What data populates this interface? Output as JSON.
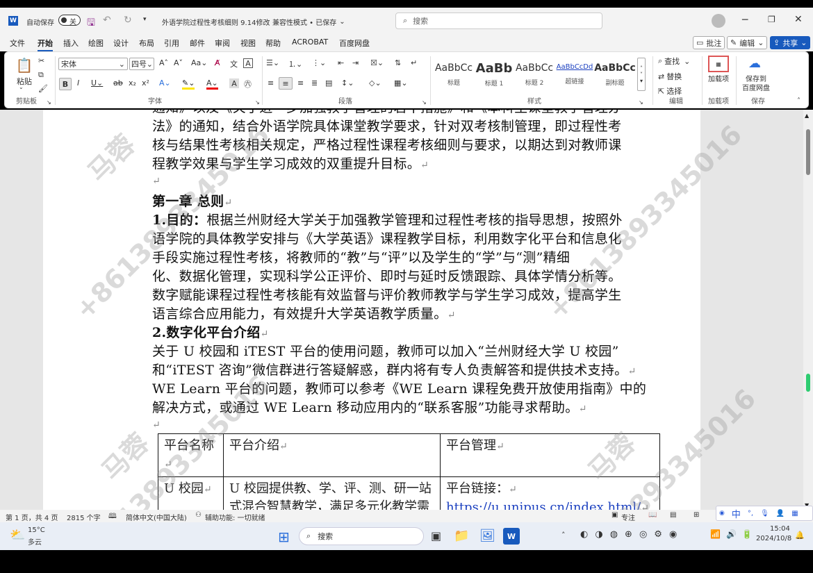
{
  "titlebar": {
    "autosave_label": "自动保存",
    "autosave_state": "关",
    "doc_title": "外语学院过程性考核细则 9.14修改",
    "doc_mode": "兼容性模式 • 已保存",
    "search_placeholder": "搜索"
  },
  "tabs": [
    "文件",
    "开始",
    "插入",
    "绘图",
    "设计",
    "布局",
    "引用",
    "邮件",
    "审阅",
    "视图",
    "帮助",
    "ACROBAT",
    "百度网盘"
  ],
  "tab_actions": {
    "comment": "批注",
    "edit": "编辑",
    "share": "共享"
  },
  "ribbon": {
    "clipboard": {
      "paste": "粘贴",
      "label": "剪贴板"
    },
    "font": {
      "font_name": "宋体",
      "font_size": "四号",
      "label": "字体"
    },
    "paragraph": {
      "label": "段落"
    },
    "styles": {
      "label": "样式",
      "items": [
        {
          "preview": "AaBbCc",
          "name": "标题"
        },
        {
          "preview": "AaBb",
          "name": "标题 1"
        },
        {
          "preview": "AaBbCc",
          "name": "标题 2"
        },
        {
          "preview": "AaBbCcDd",
          "name": "超链接"
        },
        {
          "preview": "AaBbCc",
          "name": "副标题"
        }
      ]
    },
    "editing": {
      "find": "查找",
      "replace": "替换",
      "select": "选择",
      "label": "编辑"
    },
    "addins": {
      "btn": "加载项",
      "label": "加载项"
    },
    "save": {
      "btn1": "保存到",
      "btn2": "百度网盘",
      "label": "保存"
    }
  },
  "document": {
    "lines": [
      {
        "text": "通知》以及《关于进一步加强教学管理的若干措施》和《本科生课堂教学管理办",
        "cls": ""
      },
      {
        "text": "法》的通知，结合外语学院具体课堂教学要求，针对双考核制管理，即过程性考",
        "cls": ""
      },
      {
        "text": "核与结果性考核相关规定，严格过程性课程考核细则与要求，以期达到对教师课",
        "cls": ""
      },
      {
        "text": "程教学效果与学生学习成效的双重提升目标。",
        "cls": "",
        "mark": "↵"
      },
      {
        "text": "",
        "cls": "",
        "mark": "↵"
      },
      {
        "text": "第一章  总则",
        "cls": "bold",
        "mark": "↵"
      },
      {
        "text": "1.目的：根据兰州财经大学关于加强教学管理和过程性考核的指导思想，按照外",
        "cls": "first-bold"
      },
      {
        "text": "语学院的具体教学安排与《大学英语》课程教学目标，利用数字化平台和信息化",
        "cls": ""
      },
      {
        "text": "手段实施过程性考核，将教师的“教”与“评”以及学生的“学”与“测”精细",
        "cls": ""
      },
      {
        "text": "化、数据化管理，实现科学公正评价、即时与延时反馈跟踪、具体学情分析等。",
        "cls": ""
      },
      {
        "text": "数字赋能课程过程性考核能有效监督与评价教师教学与学生学习成效，提高学生",
        "cls": ""
      },
      {
        "text": "语言综合应用能力，有效提升大学英语教学质量。",
        "cls": "",
        "mark": "↵"
      },
      {
        "text": "2.数字化平台介绍",
        "cls": "bold",
        "mark": "↵"
      },
      {
        "text": "    关于 U 校园和 iTEST 平台的使用问题，教师可以加入“兰州财经大学 U 校园”",
        "cls": ""
      },
      {
        "text": "和“iTEST 咨询”微信群进行答疑解惑，群内将有专人负责解答和提供技术支持。",
        "cls": "",
        "mark": "↵"
      },
      {
        "text": "WE Learn 平台的问题，教师可以参考《WE Learn 课程免费开放使用指南》中的",
        "cls": ""
      },
      {
        "text": "解决方式，或通过 WE Learn 移动应用内的“联系客服”功能寻求帮助。",
        "cls": "",
        "mark": "↵"
      },
      {
        "text": "",
        "cls": "",
        "mark": "↵"
      }
    ],
    "first_bold_prefix": "1.目的：",
    "table": {
      "headers": [
        "平台名称",
        "平台介绍",
        "平台管理"
      ],
      "rows": [
        [
          "U 校园",
          "U 校园提供教、学、评、测、研一站式混合智慧教学，满足多元化教学需",
          "平台链接：",
          "https://u.unipus.cn/index.html/"
        ]
      ]
    }
  },
  "watermark": {
    "name": "马蓉",
    "phone": "+8613893345016"
  },
  "statusbar": {
    "page": "第 1 页，共 4 页",
    "words": "2815 个字",
    "lang": "简体中文(中国大陆)",
    "access": "辅助功能: 一切就绪",
    "focus": "专注"
  },
  "taskbar": {
    "temp": "15°C",
    "weather": "多云",
    "search": "搜索",
    "time": "15:04",
    "date": "2024/10/8",
    "ime": "中"
  }
}
